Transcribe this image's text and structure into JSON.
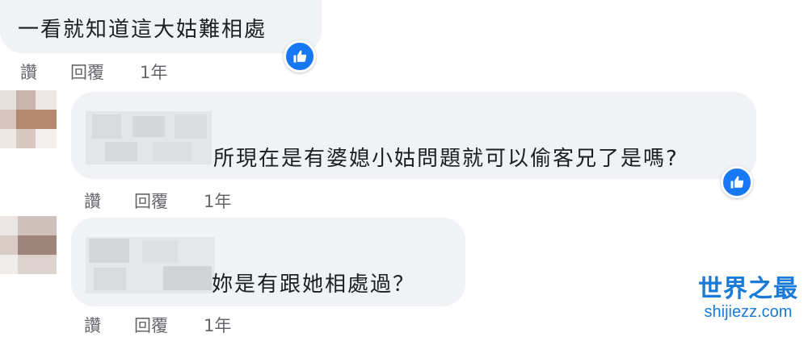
{
  "comments": [
    {
      "text": "一看就知道這大姑難相處",
      "like_label": "讚",
      "reply_label": "回覆",
      "time": "1年"
    },
    {
      "text": "所現在是有婆媳小姑問題就可以偷客兄了是嗎?",
      "like_label": "讚",
      "reply_label": "回覆",
      "time": "1年"
    },
    {
      "text": "妳是有跟她相處過？",
      "like_label": "讚",
      "reply_label": "回覆",
      "time": "1年"
    }
  ],
  "watermark": {
    "title": "世界之最",
    "url": "shijiezz.com"
  },
  "colors": {
    "bubble": "#f0f2f5",
    "like_badge": "#1877f2",
    "meta_text": "#65676b",
    "watermark": "#1a7ad8"
  }
}
